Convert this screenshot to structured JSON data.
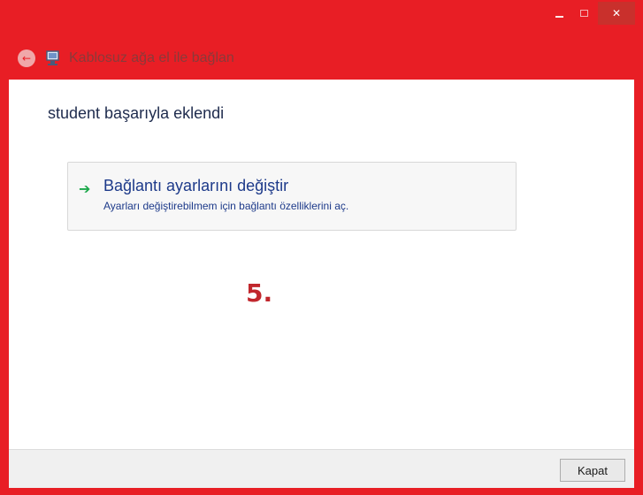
{
  "window": {
    "title_controls": {
      "close_glyph": "✕"
    },
    "nav_title": "Kablosuz ağa el ile bağlan",
    "back_glyph": "←",
    "icons": [
      "back-arrow-icon",
      "wireless-network-icon",
      "minimize-icon",
      "maximize-icon",
      "close-icon"
    ],
    "accent_color": "#e81e25"
  },
  "main": {
    "heading": "student başarıyla eklendi",
    "link": {
      "title": "Bağlantı ayarlarını değiştir",
      "description": "Ayarları değiştirebilmem için bağlantı özelliklerini aç.",
      "arrow_glyph": "➔"
    },
    "step_label": "5."
  },
  "footer": {
    "close_button_label": "Kapat"
  }
}
